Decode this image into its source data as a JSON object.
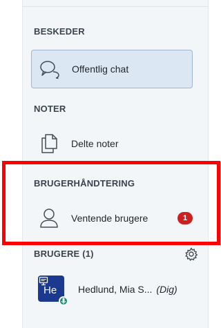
{
  "sections": {
    "messages_title": "BESKEDER",
    "notes_title": "NOTER",
    "user_management_title": "BRUGERHÅNDTERING",
    "users_title": "BRUGERE (1)"
  },
  "items": {
    "public_chat": "Offentlig chat",
    "shared_notes": "Delte noter",
    "waiting_users": "Ventende brugere",
    "waiting_users_badge": "1"
  },
  "user": {
    "avatar_initials": "He",
    "name": "Hedlund, Mia S...",
    "you_label": "(Dig)"
  },
  "colors": {
    "accent_highlight": "#ff0000",
    "badge": "#cd1f1f",
    "avatar": "#1b3a8f",
    "mic": "#0f8a6a"
  },
  "icons": {
    "chat": "chat-bubbles-icon",
    "notes": "documents-icon",
    "waiting": "person-icon",
    "settings": "gear-icon",
    "presenter": "presenter-icon",
    "mic": "microphone-icon"
  }
}
